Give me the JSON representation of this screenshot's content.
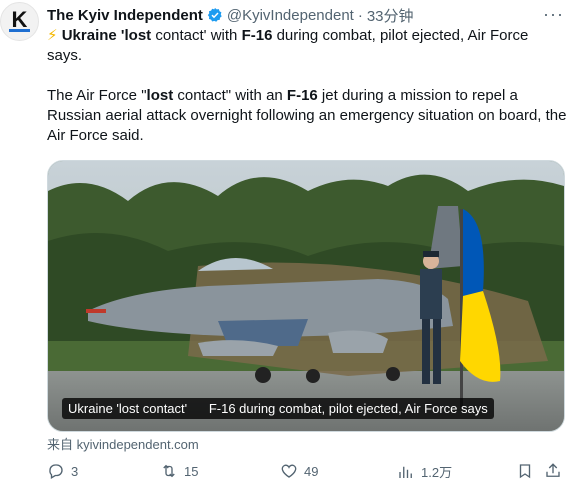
{
  "tweet": {
    "author_name": "The Kyiv Independent",
    "author_handle": "@KyivIndependent",
    "separator": "·",
    "time": "33分钟",
    "headline_emoji": "⚡",
    "headline_parts": [
      "Ukraine",
      " 'lost",
      " contact' with ",
      "F-16",
      " during combat, pilot ejected, Air Force says."
    ],
    "body_parts": [
      "The Air Force \"",
      "lost",
      " contact\" with an ",
      "F-16",
      " jet during a mission to repel a Russian aerial attack overnight following an emergency situation on board, the Air Force said."
    ],
    "caption_left": "Ukraine 'lost contact'",
    "caption_right": "F-16 during combat, pilot ejected, Air Force says",
    "source": "来自 kyivindependent.com",
    "replies": "3",
    "reposts": "15",
    "likes": "49",
    "views": "1.2万"
  },
  "icons": {
    "verified": "verified-badge-icon",
    "more": "more-dots-icon",
    "reply": "reply-icon",
    "repost": "repost-icon",
    "like": "heart-icon",
    "views": "views-chart-icon",
    "bookmark": "bookmark-icon",
    "share": "share-icon"
  },
  "colors": {
    "verified_blue": "#1d9bf0",
    "secondary_text": "#536471",
    "flag_blue": "#0057b7",
    "flag_yellow": "#ffd700"
  }
}
